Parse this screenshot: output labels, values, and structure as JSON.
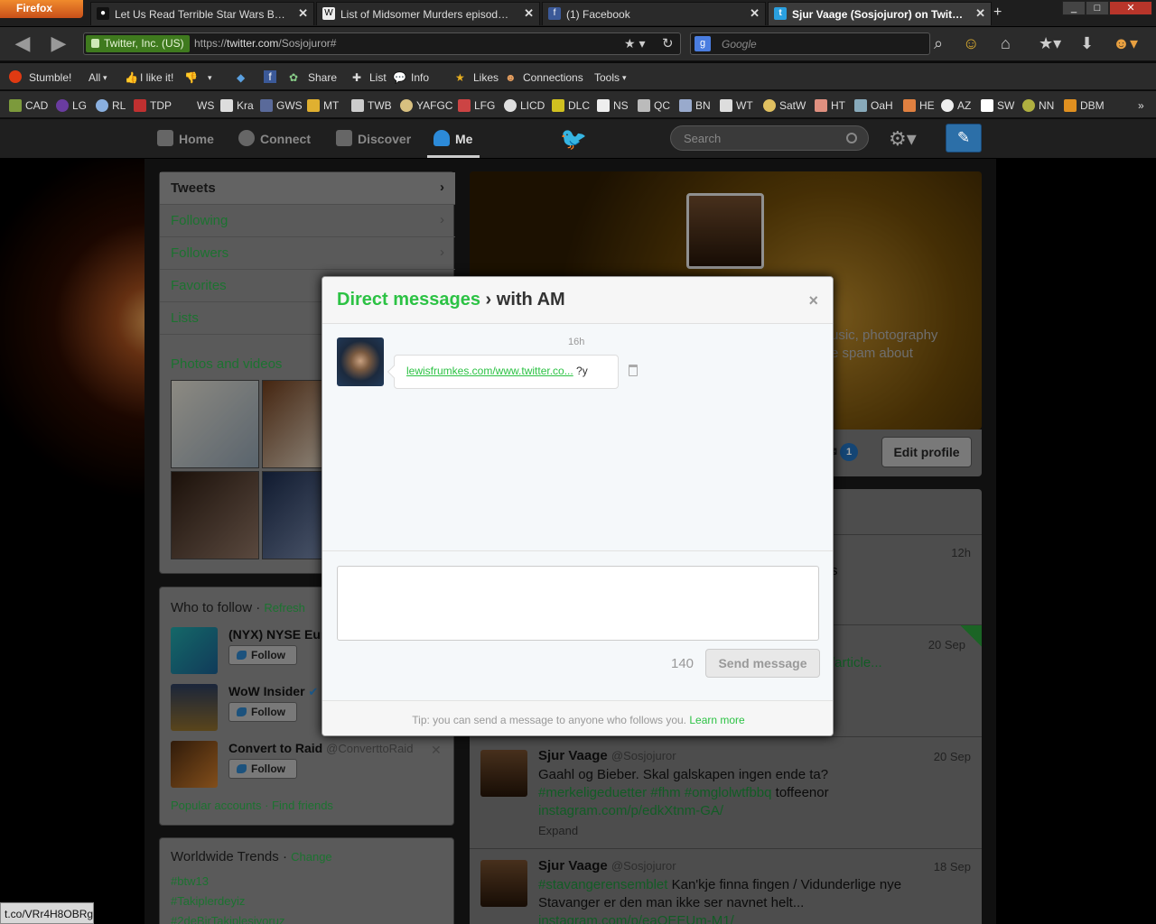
{
  "browser": {
    "app_button": "Firefox",
    "tabs": [
      {
        "label": "Let Us Read Terrible Star Wars Book...",
        "active": false
      },
      {
        "label": "List of Midsomer Murders episodes ...",
        "active": false
      },
      {
        "label": "(1) Facebook",
        "active": false
      },
      {
        "label": "Sjur Vaage (Sosjojuror) on Twitter",
        "active": true
      }
    ],
    "new_tab": "+",
    "identity": "Twitter, Inc. (US)",
    "url_prefix": "https://",
    "url_domain": "twitter.com",
    "url_path": "/Sosjojuror#",
    "search_placeholder": "Google",
    "status_url": "t.co/VRr4H8OBRg"
  },
  "stumble_bar": {
    "stumble": "Stumble!",
    "all": "All",
    "like": "I like it!",
    "share": "Share",
    "list": "List",
    "info": "Info",
    "likes": "Likes",
    "connections": "Connections",
    "tools": "Tools"
  },
  "bookmarks": [
    "CAD",
    "LG",
    "RL",
    "TDP",
    "WS",
    "Kra",
    "GWS",
    "MT",
    "TWB",
    "YAFGC",
    "LFG",
    "LICD",
    "DLC",
    "NS",
    "QC",
    "BN",
    "WT",
    "SatW",
    "HT",
    "OaH",
    "HE",
    "AZ",
    "SW",
    "NN",
    "DBM"
  ],
  "twitter_nav": {
    "home": "Home",
    "connect": "Connect",
    "discover": "Discover",
    "me": "Me",
    "search_placeholder": "Search"
  },
  "profile_nav": {
    "tweets": "Tweets",
    "following": "Following",
    "followers": "Followers",
    "favorites": "Favorites",
    "lists": "Lists",
    "photos": "Photos and videos"
  },
  "who_to_follow": {
    "title": "Who to follow",
    "sep": " · ",
    "refresh": "Refresh",
    "follow_label": "Follow",
    "accounts": [
      {
        "name": "(NYX) NYSE Euro",
        "handle": ""
      },
      {
        "name": "WoW Insider",
        "handle": ""
      },
      {
        "name": "Convert to Raid",
        "handle": "@ConverttoRaid"
      }
    ],
    "popular": "Popular accounts",
    "find_friends": "Find friends"
  },
  "trends": {
    "title": "Worldwide Trends",
    "change": "Change",
    "items": [
      "#btw13",
      "#Takiplerdeyiz",
      "#2deBirTakiplesiyoruz"
    ]
  },
  "profile": {
    "bio_line1": "usic, photography",
    "bio_line2": "e spam about",
    "edit_profile": "Edit profile",
    "dm_count": "1"
  },
  "timeline": [
    {
      "name": "",
      "handle": "",
      "time": "12h",
      "text": "s"
    },
    {
      "name": "",
      "handle": "",
      "time": "20 Sep",
      "text": "/article..."
    },
    {
      "name": "Sjur Vaage",
      "handle": "@Sosjojuror",
      "time": "20 Sep",
      "text_plain": "Gaahl og Bieber. Skal galskapen ingen ende ta?",
      "tags": "#merkeligeduetter #fhm #omglolwtfbbq",
      "text_tail": " toffeenor ",
      "link": "instagram.com/p/edkXtnm-GA/",
      "expand": "Expand"
    },
    {
      "name": "Sjur Vaage",
      "handle": "@Sosjojuror",
      "time": "18 Sep",
      "tag": "#stavangerensemblet",
      "text_plain": " Kan'kje finna fingen / Vidunderlige nye Stavanger er den man ikke ser navnet helt...",
      "link": "instagram.com/p/eaOEEUm-M1/"
    }
  ],
  "dm_modal": {
    "title_link": "Direct messages",
    "title_rest": " › with AM",
    "close": "×",
    "message_time": "16h",
    "message_link": "lewisfrumkes.com/www.twitter.co...",
    "message_tail": " ?y",
    "compose_value": "",
    "counter": "140",
    "send_label": "Send message",
    "tip": "Tip: you can send a message to anyone who follows you.",
    "learn_more": "Learn more"
  },
  "colors": {
    "twitter_green": "#2cc244",
    "firefox_orange": "#e8772a",
    "identity_green": "#3f7a1e",
    "compose_blue": "#2c6fa8"
  }
}
